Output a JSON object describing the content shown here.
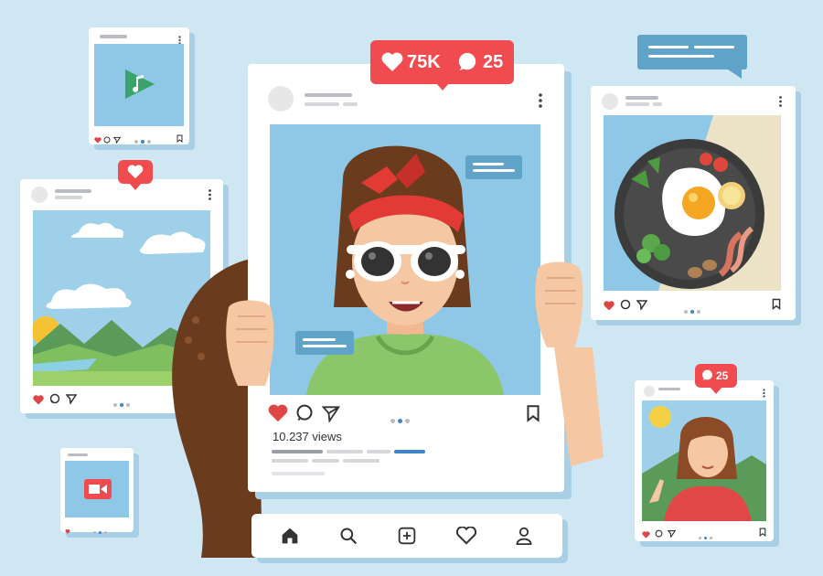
{
  "main_post": {
    "like_count": "75K",
    "comment_count": "25",
    "views_label": "10.237 views"
  },
  "small_post": {
    "comment_count": "25"
  },
  "icons": [
    "heart-icon",
    "comment-icon",
    "share-icon",
    "bookmark-icon",
    "home-icon",
    "search-icon",
    "add-icon",
    "profile-icon",
    "play-icon",
    "music-note-icon",
    "video-camera-icon",
    "kebab-menu-icon"
  ],
  "colors": {
    "background": "#cfe6f3",
    "accent_red": "#f04b4f",
    "accent_blue": "#3a86c8",
    "speech_bubble": "#5fa3c8"
  }
}
